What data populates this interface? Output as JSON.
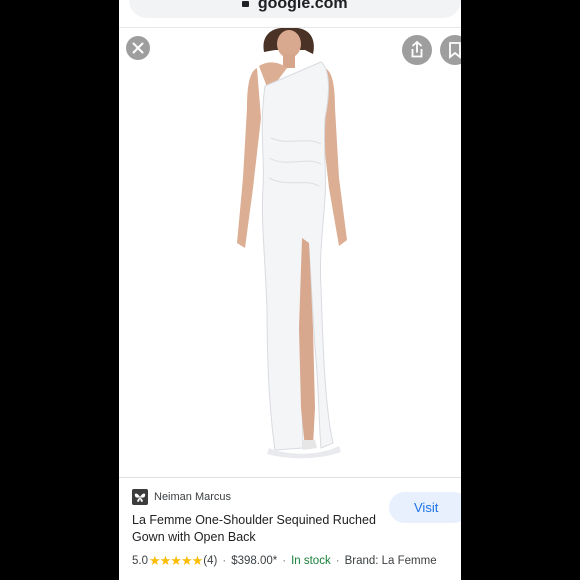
{
  "browser": {
    "url": "google.com"
  },
  "product": {
    "merchant": "Neiman Marcus",
    "title": "La Femme One-Shoulder Sequined Ruched Gown with Open Back",
    "rating": "5.0",
    "stars": "★★★★★",
    "review_count": "(4)",
    "price": "$398.00*",
    "availability": "In stock",
    "brand": "Brand: La Femme",
    "visit_label": "Visit"
  },
  "icons": {
    "close": "close-icon",
    "share": "share-icon",
    "save": "bookmark-icon",
    "merchant_logo": "butterfly-logo"
  },
  "colors": {
    "accent": "#1a73e8",
    "in_stock": "#188038",
    "star": "#fbbc04"
  }
}
